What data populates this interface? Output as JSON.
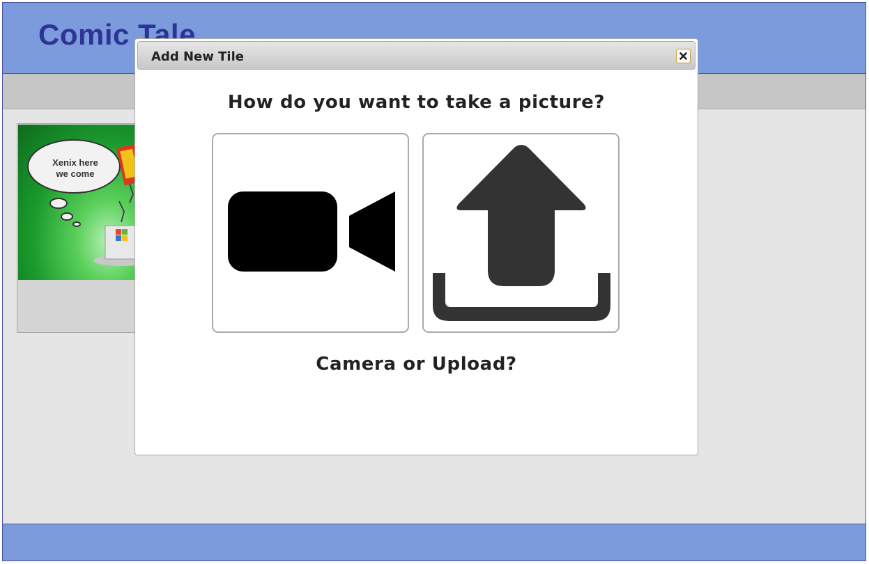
{
  "app": {
    "title": "Comic Tale"
  },
  "tile": {
    "bubble_line1": "Xenix here",
    "bubble_line2": "we come"
  },
  "modal": {
    "title": "Add New Tile",
    "close_icon": "close-icon",
    "question": "How do you want to take a picture?",
    "options": [
      {
        "name": "camera",
        "icon": "video-camera-icon"
      },
      {
        "name": "upload",
        "icon": "upload-icon"
      }
    ],
    "subquestion": "Camera or Upload?"
  },
  "colors": {
    "header": "#7b9bdc",
    "title_text": "#2e3396",
    "toolbar": "#c6c6c6",
    "background": "#e5e5e5",
    "upload_icon": "#333333",
    "camera_icon": "#000000"
  }
}
